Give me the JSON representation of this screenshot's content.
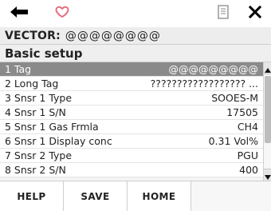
{
  "topbar": {
    "back_icon": "back-arrow-icon",
    "favorite_icon": "heart-icon",
    "document_icon": "document-icon",
    "close_icon": "close-icon"
  },
  "header": {
    "device_label": "VECTOR:",
    "device_id": "@@@@@@@@"
  },
  "section": {
    "title": "Basic setup"
  },
  "list": {
    "rows": [
      {
        "label": "1 Tag",
        "value": "@@@@@@@@@",
        "selected": true
      },
      {
        "label": "2 Long Tag",
        "value": "?????????????????? ..."
      },
      {
        "label": "3 Snsr 1 Type",
        "value": "SOOES-M"
      },
      {
        "label": "4 Snsr 1 S/N",
        "value": "17505"
      },
      {
        "label": "5 Snsr 1 Gas Frmla",
        "value": "CH4"
      },
      {
        "label": "6 Snsr 1 Display conc",
        "value": "0.31 Vol%"
      },
      {
        "label": "7 Snsr 2 Type",
        "value": "PGU"
      },
      {
        "label": "8 Snsr 2 S/N",
        "value": "400"
      }
    ],
    "scroll_position_fraction": 0.08,
    "scroll_visible_fraction": 0.7
  },
  "bottom": {
    "help_label": "HELP",
    "save_label": "SAVE",
    "home_label": "HOME"
  },
  "colors": {
    "selected_bg": "#8a8a8a",
    "heart": "#e36d7f"
  }
}
